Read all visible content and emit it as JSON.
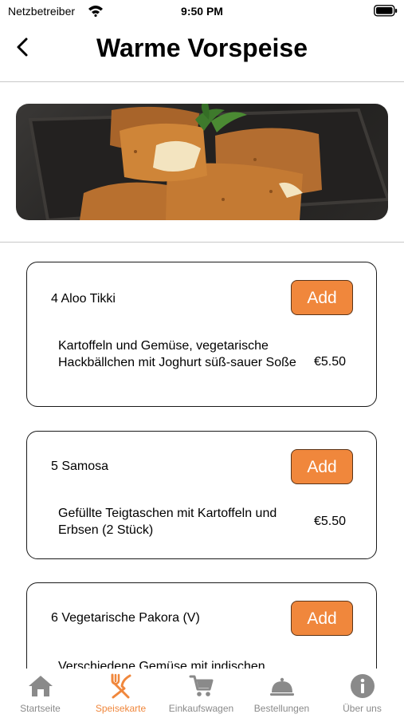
{
  "status": {
    "carrier": "Netzbetreiber",
    "time": "9:50 PM"
  },
  "nav": {
    "title": "Warme Vorspeise"
  },
  "colors": {
    "accent": "#f0873c",
    "inactive": "#8a8a8a"
  },
  "items": [
    {
      "title": "4 Aloo Tikki",
      "add_label": "Add",
      "description": "Kartoffeln und Gemüse, vegetarische Hackbällchen mit Joghurt süß-sauer Soße",
      "price": "€5.50"
    },
    {
      "title": "5 Samosa",
      "add_label": "Add",
      "description": "Gefüllte Teigtaschen mit Kartoffeln und Erbsen (2 Stück)",
      "price": "€5.50"
    },
    {
      "title": "6 Vegetarische Pakora (V)",
      "add_label": "Add",
      "description": "Verschiedene Gemüse mit indischen",
      "price": ""
    }
  ],
  "tabs": [
    {
      "label": "Startseite",
      "icon": "home-icon"
    },
    {
      "label": "Speisekarte",
      "icon": "fork-knife-icon",
      "active": true
    },
    {
      "label": "Einkaufswagen",
      "icon": "cart-icon"
    },
    {
      "label": "Bestellungen",
      "icon": "cloche-icon"
    },
    {
      "label": "Über uns",
      "icon": "info-icon"
    }
  ]
}
